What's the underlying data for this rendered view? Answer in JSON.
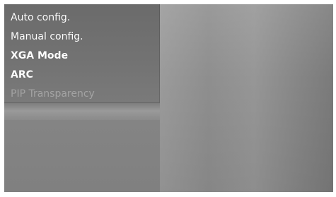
{
  "menu": {
    "items": [
      {
        "label": "Auto config.",
        "state": "enabled"
      },
      {
        "label": "Manual config.",
        "state": "enabled"
      },
      {
        "label": "XGA Mode",
        "state": "enabled"
      },
      {
        "label": "ARC",
        "state": "enabled"
      },
      {
        "label": "PIP Transparency",
        "state": "disabled"
      }
    ]
  },
  "colors": {
    "menu_text": "#ffffff",
    "menu_text_disabled": "#a3a3a3",
    "panel_background": "#6b6b6b"
  }
}
